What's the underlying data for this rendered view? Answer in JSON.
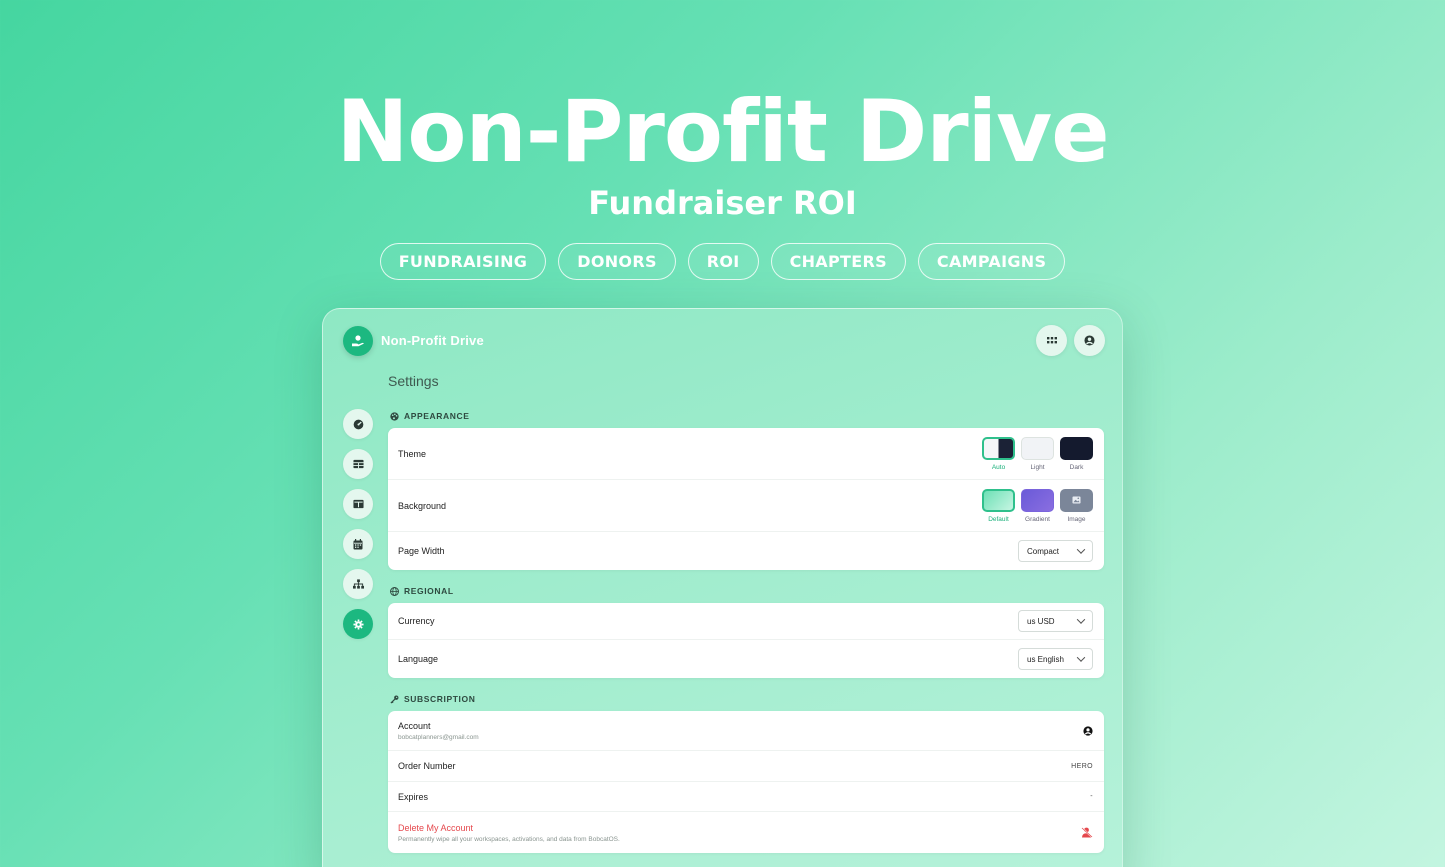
{
  "hero": {
    "title": "Non-Profit Drive",
    "subtitle": "Fundraiser ROI",
    "tags": [
      "FUNDRAISING",
      "DONORS",
      "ROI",
      "CHAPTERS",
      "CAMPAIGNS"
    ]
  },
  "app": {
    "name": "Non-Profit Drive",
    "page_title": "Settings",
    "header_buttons": [
      "grid-icon",
      "user-circle-icon"
    ],
    "nav_icons": [
      "dashboard-icon",
      "table-icon",
      "layout-icon",
      "calendar-icon",
      "hierarchy-icon",
      "settings-icon"
    ],
    "active_nav": "settings-icon",
    "accent_color": "#1cb880"
  },
  "appearance": {
    "label": "APPEARANCE",
    "theme_label": "Theme",
    "theme_options": [
      "Auto",
      "Light",
      "Dark"
    ],
    "theme_selected": "Auto",
    "background_label": "Background",
    "background_options": [
      "Default",
      "Gradient",
      "Image"
    ],
    "background_selected": "Default",
    "page_width_label": "Page Width",
    "page_width_value": "Compact"
  },
  "regional": {
    "label": "REGIONAL",
    "currency_label": "Currency",
    "currency_value": "us USD",
    "language_label": "Language",
    "language_value": "us English"
  },
  "subscription": {
    "label": "SUBSCRIPTION",
    "account_label": "Account",
    "account_email": "bobcatplanners@gmail.com",
    "order_label": "Order Number",
    "order_value": "HERO",
    "expires_label": "Expires",
    "expires_value": "-",
    "delete_label": "Delete My Account",
    "delete_desc": "Permanently wipe all your workspaces, activations, and data from BobcatOS.",
    "danger_color": "#e5484d"
  }
}
